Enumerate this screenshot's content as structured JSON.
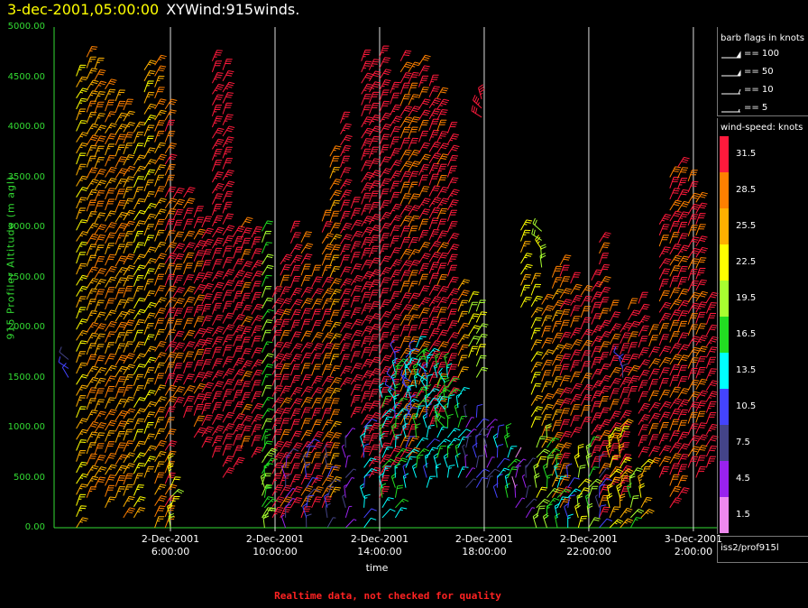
{
  "header": {
    "timestamp": "3-dec-2001,05:00:00",
    "product": "XYWind:915winds."
  },
  "legend": {
    "barb_title": "barb flags in knots",
    "barbs": [
      {
        "label": "== 100",
        "kind": "pennant"
      },
      {
        "label": "== 50",
        "kind": "flag"
      },
      {
        "label": "== 10",
        "kind": "full"
      },
      {
        "label": "== 5",
        "kind": "half"
      }
    ],
    "speed_title": "wind-speed: knots",
    "speeds": [
      {
        "label": "31.5",
        "color": "#ff1a3c"
      },
      {
        "label": "28.5",
        "color": "#ff8000"
      },
      {
        "label": "25.5",
        "color": "#ffb000"
      },
      {
        "label": "22.5",
        "color": "#ffff00"
      },
      {
        "label": "19.5",
        "color": "#a8ff30"
      },
      {
        "label": "16.5",
        "color": "#22dd22"
      },
      {
        "label": "13.5",
        "color": "#00ffff"
      },
      {
        "label": "10.5",
        "color": "#4444ff"
      },
      {
        "label": "7.5",
        "color": "#444488"
      },
      {
        "label": "4.5",
        "color": "#9922ee"
      },
      {
        "label": "1.5",
        "color": "#ee88ee"
      }
    ]
  },
  "station": "iss2/prof915l",
  "footer_note": "Realtime data, not checked for quality",
  "chart_data": {
    "type": "wind-barb time-height",
    "ylabel": "915 Profiler Altitude (m agl)",
    "xlabel": "time",
    "ylim": [
      0,
      5000
    ],
    "yticks": [
      "0.00",
      "500.00",
      "1000.00",
      "1500.00",
      "2000.00",
      "2500.00",
      "3000.00",
      "3500.00",
      "4000.00",
      "4500.00",
      "5000.00"
    ],
    "xticks": [
      {
        "date": "3-Dec-2001",
        "time": "2:00:00"
      },
      {
        "date": "2-Dec-2001",
        "time": "22:00:00"
      },
      {
        "date": "2-Dec-2001",
        "time": "18:00:00"
      },
      {
        "date": "2-Dec-2001",
        "time": "14:00:00"
      },
      {
        "date": "2-Dec-2001",
        "time": "10:00:00"
      },
      {
        "date": "2-Dec-2001",
        "time": "6:00:00"
      }
    ],
    "x_hours_before_end": [
      27,
      23,
      19,
      15,
      11,
      7,
      3
    ],
    "tick_hours_before_end": [
      3,
      7,
      11,
      15,
      19,
      23
    ],
    "grid": "vertical lines at time ticks",
    "columns": [
      {
        "h": 26.6,
        "from": 0,
        "to": 4600,
        "speed": 24
      },
      {
        "h": 26.2,
        "from": 300,
        "to": 4700,
        "speed": 26
      },
      {
        "h": 25.9,
        "from": 400,
        "to": 4600,
        "speed": 27
      },
      {
        "h": 25.5,
        "from": 200,
        "to": 4400,
        "speed": 28
      },
      {
        "h": 25.1,
        "from": 300,
        "to": 4300,
        "speed": 27
      },
      {
        "h": 24.8,
        "from": 100,
        "to": 4200,
        "speed": 26
      },
      {
        "h": 24.4,
        "from": 100,
        "to": 4000,
        "speed": 24
      },
      {
        "h": 24.0,
        "from": 500,
        "to": 4600,
        "speed": 25
      },
      {
        "h": 23.6,
        "from": 0,
        "to": 4700,
        "speed": 27
      },
      {
        "h": 23.2,
        "from": 0,
        "to": 4200,
        "speed": 29
      },
      {
        "h": 22.9,
        "from": 1200,
        "to": 3300,
        "speed": 31
      },
      {
        "h": 22.5,
        "from": 1100,
        "to": 3400,
        "speed": 30
      },
      {
        "h": 22.1,
        "from": 900,
        "to": 3200,
        "speed": 31
      },
      {
        "h": 21.8,
        "from": 800,
        "to": 3100,
        "speed": 32
      },
      {
        "h": 21.4,
        "from": 700,
        "to": 4700,
        "speed": 33
      },
      {
        "h": 21.0,
        "from": 500,
        "to": 4600,
        "speed": 32
      },
      {
        "h": 20.6,
        "from": 600,
        "to": 3000,
        "speed": 32
      },
      {
        "h": 20.3,
        "from": 800,
        "to": 3100,
        "speed": 31
      },
      {
        "h": 19.9,
        "from": 700,
        "to": 3000,
        "speed": 32
      },
      {
        "h": 19.5,
        "from": 100,
        "to": 3000,
        "speed": 18
      },
      {
        "h": 19.1,
        "from": 100,
        "to": 2400,
        "speed": 32
      },
      {
        "h": 18.8,
        "from": 100,
        "to": 2700,
        "speed": 31
      },
      {
        "h": 18.4,
        "from": 200,
        "to": 3000,
        "speed": 32
      },
      {
        "h": 18.0,
        "from": 100,
        "to": 2900,
        "speed": 30
      },
      {
        "h": 17.6,
        "from": 200,
        "to": 2600,
        "speed": 31
      },
      {
        "h": 17.2,
        "from": 200,
        "to": 3100,
        "speed": 29
      },
      {
        "h": 16.9,
        "from": 300,
        "to": 3800,
        "speed": 27
      },
      {
        "h": 16.5,
        "from": 1400,
        "to": 4100,
        "speed": 33
      },
      {
        "h": 16.1,
        "from": 1100,
        "to": 3200,
        "speed": 32
      },
      {
        "h": 15.7,
        "from": 700,
        "to": 4700,
        "speed": 33
      },
      {
        "h": 15.4,
        "from": 500,
        "to": 4600,
        "speed": 33
      },
      {
        "h": 15.0,
        "from": 300,
        "to": 4700,
        "speed": 32
      },
      {
        "h": 14.6,
        "from": 600,
        "to": 4400,
        "speed": 33
      },
      {
        "h": 14.2,
        "from": 700,
        "to": 4700,
        "speed": 30
      },
      {
        "h": 13.9,
        "from": 700,
        "to": 4600,
        "speed": 29
      },
      {
        "h": 13.5,
        "from": 1100,
        "to": 4700,
        "speed": 31
      },
      {
        "h": 13.1,
        "from": 1000,
        "to": 4500,
        "speed": 32
      },
      {
        "h": 12.8,
        "from": 1100,
        "to": 4300,
        "speed": 31
      },
      {
        "h": 12.4,
        "from": 1300,
        "to": 4000,
        "speed": 32
      },
      {
        "h": 12.0,
        "from": 1500,
        "to": 2400,
        "speed": 26
      },
      {
        "h": 11.6,
        "from": 1700,
        "to": 2300,
        "speed": 22
      },
      {
        "h": 11.3,
        "from": 1500,
        "to": 2200,
        "speed": 20
      },
      {
        "h": 9.6,
        "from": 2200,
        "to": 3000,
        "speed": 24
      },
      {
        "h": 9.2,
        "from": 1000,
        "to": 2500,
        "speed": 23
      },
      {
        "h": 8.8,
        "from": 800,
        "to": 2300,
        "speed": 27
      },
      {
        "h": 8.4,
        "from": 300,
        "to": 2600,
        "speed": 28
      },
      {
        "h": 8.1,
        "from": 200,
        "to": 2700,
        "speed": 30
      },
      {
        "h": 7.7,
        "from": 900,
        "to": 2500,
        "speed": 31
      },
      {
        "h": 7.3,
        "from": 1000,
        "to": 2400,
        "speed": 30
      },
      {
        "h": 6.9,
        "from": 600,
        "to": 2500,
        "speed": 32
      },
      {
        "h": 6.6,
        "from": 100,
        "to": 2900,
        "speed": 31
      },
      {
        "h": 6.2,
        "from": 400,
        "to": 2200,
        "speed": 31
      },
      {
        "h": 5.8,
        "from": 300,
        "to": 2000,
        "speed": 32
      },
      {
        "h": 5.5,
        "from": 1300,
        "to": 2200,
        "speed": 31
      },
      {
        "h": 5.1,
        "from": 700,
        "to": 2300,
        "speed": 32
      },
      {
        "h": 4.7,
        "from": 600,
        "to": 2000,
        "speed": 30
      },
      {
        "h": 4.3,
        "from": 500,
        "to": 3100,
        "speed": 31
      },
      {
        "h": 3.9,
        "from": 200,
        "to": 3600,
        "speed": 30
      },
      {
        "h": 3.6,
        "from": 300,
        "to": 3700,
        "speed": 31
      },
      {
        "h": 3.2,
        "from": 600,
        "to": 3500,
        "speed": 30
      },
      {
        "h": 2.9,
        "from": 500,
        "to": 3300,
        "speed": 31
      },
      {
        "h": 2.5,
        "from": 600,
        "to": 2300,
        "speed": 32
      }
    ],
    "low_level": [
      {
        "h": 23.0,
        "from": 0,
        "to": 600,
        "speed": 22
      },
      {
        "h": 19.4,
        "from": 0,
        "to": 800,
        "speed": 17
      },
      {
        "h": 18.6,
        "from": 0,
        "to": 700,
        "speed": 6
      },
      {
        "h": 17.8,
        "from": 0,
        "to": 800,
        "speed": 10
      },
      {
        "h": 17.0,
        "from": 0,
        "to": 700,
        "speed": 8
      },
      {
        "h": 16.3,
        "from": 0,
        "to": 900,
        "speed": 5
      },
      {
        "h": 15.6,
        "from": 0,
        "to": 1000,
        "speed": 12
      },
      {
        "h": 14.9,
        "from": 100,
        "to": 1300,
        "speed": 14
      },
      {
        "h": 14.4,
        "from": 100,
        "to": 1600,
        "speed": 16
      },
      {
        "h": 14.0,
        "from": 400,
        "to": 1700,
        "speed": 13
      },
      {
        "h": 13.6,
        "from": 500,
        "to": 1800,
        "speed": 16
      },
      {
        "h": 13.2,
        "from": 400,
        "to": 1700,
        "speed": 13
      },
      {
        "h": 12.8,
        "from": 500,
        "to": 1600,
        "speed": 15
      },
      {
        "h": 12.4,
        "from": 500,
        "to": 1600,
        "speed": 15
      },
      {
        "h": 12.0,
        "from": 500,
        "to": 1300,
        "speed": 14
      },
      {
        "h": 11.7,
        "from": 400,
        "to": 1100,
        "speed": 5
      },
      {
        "h": 11.3,
        "from": 400,
        "to": 1100,
        "speed": 10
      },
      {
        "h": 10.9,
        "from": 400,
        "to": 1000,
        "speed": 6
      },
      {
        "h": 10.5,
        "from": 300,
        "to": 900,
        "speed": 12
      },
      {
        "h": 10.1,
        "from": 300,
        "to": 900,
        "speed": 16
      },
      {
        "h": 9.8,
        "from": 200,
        "to": 700,
        "speed": 4
      },
      {
        "h": 9.4,
        "from": 100,
        "to": 600,
        "speed": 6
      },
      {
        "h": 9.0,
        "from": 0,
        "to": 800,
        "speed": 20
      },
      {
        "h": 8.6,
        "from": 0,
        "to": 900,
        "speed": 17
      },
      {
        "h": 8.2,
        "from": 0,
        "to": 600,
        "speed": 14
      },
      {
        "h": 7.8,
        "from": 0,
        "to": 500,
        "speed": 11
      },
      {
        "h": 7.4,
        "from": 0,
        "to": 700,
        "speed": 21
      },
      {
        "h": 7.0,
        "from": 0,
        "to": 800,
        "speed": 19
      },
      {
        "h": 6.6,
        "from": 0,
        "to": 600,
        "speed": 9
      },
      {
        "h": 6.2,
        "from": 0,
        "to": 900,
        "speed": 23
      },
      {
        "h": 5.8,
        "from": 0,
        "to": 1000,
        "speed": 25
      },
      {
        "h": 5.4,
        "from": 0,
        "to": 500,
        "speed": 18
      },
      {
        "h": 5.0,
        "from": 100,
        "to": 600,
        "speed": 24
      }
    ],
    "patches": [
      {
        "h": 14.4,
        "from": 1100,
        "to": 1800,
        "speed": 12
      },
      {
        "h": 13.8,
        "from": 1100,
        "to": 1800,
        "speed": 11
      },
      {
        "h": 13.2,
        "from": 1200,
        "to": 1700,
        "speed": 14
      },
      {
        "h": 12.5,
        "from": 1000,
        "to": 1500,
        "speed": 16
      },
      {
        "h": 26.9,
        "from": 1500,
        "to": 1700,
        "speed": 10
      },
      {
        "h": 5.7,
        "from": 1500,
        "to": 1700,
        "speed": 10
      },
      {
        "h": 8.8,
        "from": 2600,
        "to": 3000,
        "speed": 21
      },
      {
        "h": 11.1,
        "from": 4100,
        "to": 4300,
        "speed": 32
      }
    ]
  }
}
